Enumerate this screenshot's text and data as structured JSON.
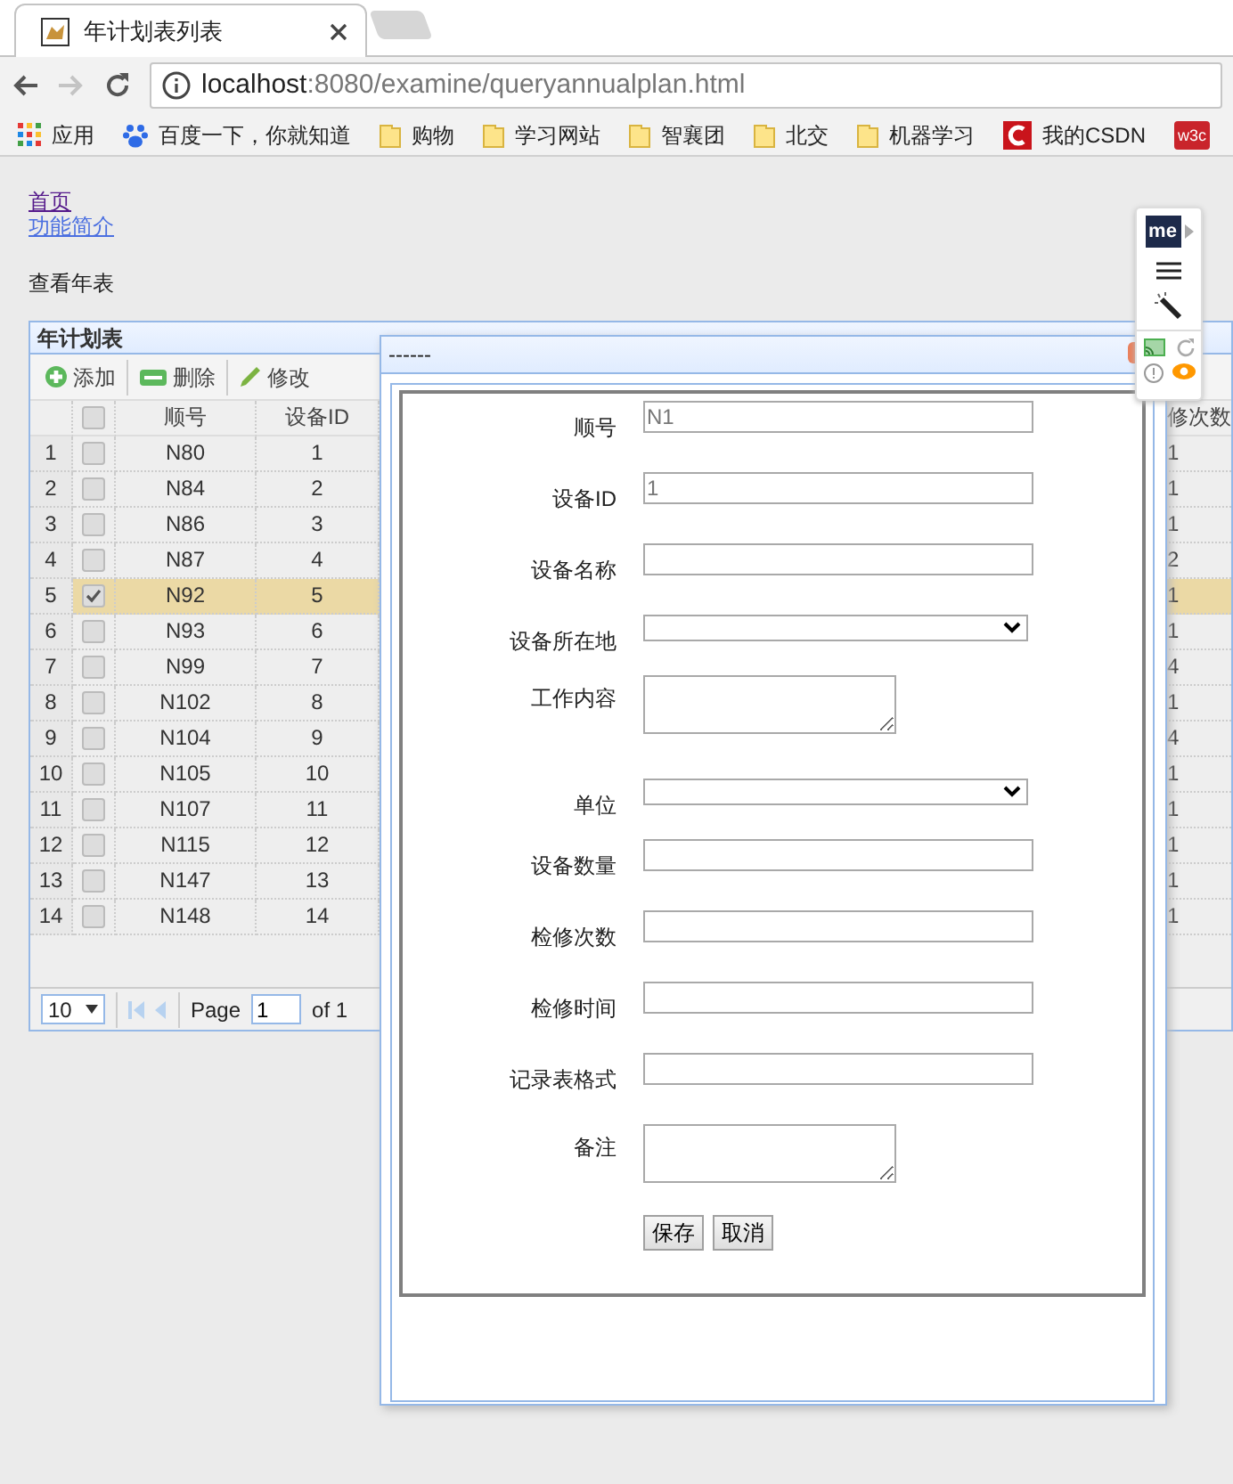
{
  "browser": {
    "tab_title": "年计划表列表",
    "address": {
      "host": "localhost",
      "path": ":8080/examine/queryannualplan.html"
    },
    "bookmarks": [
      {
        "kind": "apps",
        "label": "应用"
      },
      {
        "kind": "baidu",
        "label": "百度一下，你就知道"
      },
      {
        "kind": "folder",
        "label": "购物"
      },
      {
        "kind": "folder",
        "label": "学习网站"
      },
      {
        "kind": "folder",
        "label": "智襄团"
      },
      {
        "kind": "folder",
        "label": "北交"
      },
      {
        "kind": "folder",
        "label": "机器学习"
      },
      {
        "kind": "csdn",
        "label": "我的CSDN"
      },
      {
        "kind": "w3c",
        "label": "w3c"
      }
    ]
  },
  "page": {
    "nav_links": [
      "首页",
      "功能简介"
    ],
    "heading": "查看年表"
  },
  "grid": {
    "title": "年计划表",
    "toolbar": [
      {
        "kind": "add",
        "label": "添加"
      },
      {
        "kind": "remove",
        "label": "删除"
      },
      {
        "kind": "edit",
        "label": "修改"
      }
    ],
    "header_checked": false,
    "columns": [
      "顺号",
      "设备ID"
    ],
    "last_column": "修次数",
    "rows": [
      {
        "number": "1",
        "checked": false,
        "selected": false,
        "cells": [
          "N80",
          "1"
        ],
        "last": "1"
      },
      {
        "number": "2",
        "checked": false,
        "selected": false,
        "cells": [
          "N84",
          "2"
        ],
        "last": "1"
      },
      {
        "number": "3",
        "checked": false,
        "selected": false,
        "cells": [
          "N86",
          "3"
        ],
        "last": "1"
      },
      {
        "number": "4",
        "checked": false,
        "selected": false,
        "cells": [
          "N87",
          "4"
        ],
        "last": "2"
      },
      {
        "number": "5",
        "checked": true,
        "selected": true,
        "cells": [
          "N92",
          "5"
        ],
        "last": "1"
      },
      {
        "number": "6",
        "checked": false,
        "selected": false,
        "cells": [
          "N93",
          "6"
        ],
        "last": "1"
      },
      {
        "number": "7",
        "checked": false,
        "selected": false,
        "cells": [
          "N99",
          "7"
        ],
        "last": "4"
      },
      {
        "number": "8",
        "checked": false,
        "selected": false,
        "cells": [
          "N102",
          "8"
        ],
        "last": "1"
      },
      {
        "number": "9",
        "checked": false,
        "selected": false,
        "cells": [
          "N104",
          "9"
        ],
        "last": "4"
      },
      {
        "number": "10",
        "checked": false,
        "selected": false,
        "cells": [
          "N105",
          "10"
        ],
        "last": "1"
      },
      {
        "number": "11",
        "checked": false,
        "selected": false,
        "cells": [
          "N107",
          "11"
        ],
        "last": "1"
      },
      {
        "number": "12",
        "checked": false,
        "selected": false,
        "cells": [
          "N115",
          "12"
        ],
        "last": "1"
      },
      {
        "number": "13",
        "checked": false,
        "selected": false,
        "cells": [
          "N147",
          "13"
        ],
        "last": "1"
      },
      {
        "number": "14",
        "checked": false,
        "selected": false,
        "cells": [
          "N148",
          "14"
        ],
        "last": "1"
      }
    ],
    "pager": {
      "page_size": "10",
      "page_label": "Page",
      "page": "1",
      "of": "of 1"
    }
  },
  "dialog": {
    "title": "------",
    "fields": [
      {
        "kind": "text",
        "label": "顺号",
        "value": "N1"
      },
      {
        "kind": "text",
        "label": "设备ID",
        "value": "1"
      },
      {
        "kind": "text",
        "label": "设备名称"
      },
      {
        "kind": "select",
        "label": "设备所在地"
      },
      {
        "kind": "textarea",
        "label": "工作内容"
      },
      {
        "kind": "select",
        "label": "单位"
      },
      {
        "kind": "text",
        "label": "设备数量"
      },
      {
        "kind": "text",
        "label": "检修次数"
      },
      {
        "kind": "text",
        "label": "检修时间"
      },
      {
        "kind": "text",
        "label": "记录表格式"
      },
      {
        "kind": "textarea",
        "label": "备注"
      }
    ],
    "buttons": [
      "保存",
      "取消"
    ]
  },
  "extension": {
    "logo": "me"
  }
}
